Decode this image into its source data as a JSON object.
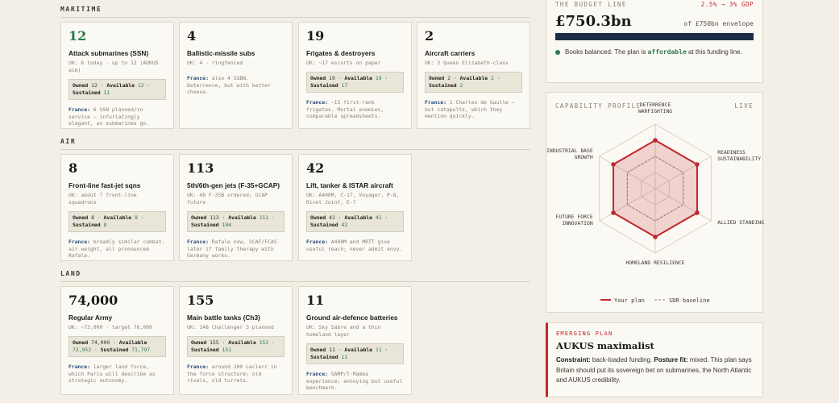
{
  "sections": {
    "maritime": "MARITIME",
    "air": "AIR",
    "land": "LAND"
  },
  "maritime": [
    {
      "num": "12",
      "title": "Attack submarines (SSN)",
      "uk": "UK: 6 today · up to 12 (AUKUS aim)",
      "owned": "12",
      "available": "12",
      "sustained": "11",
      "france_label": "France:",
      "france": "6 SSN planned/in service — infuriatingly elegant, as submarines go."
    },
    {
      "num": "4",
      "title": "Ballistic-missile subs",
      "uk": "UK: 4 · ringfenced",
      "france_label": "France:",
      "france": "also 4 SSBN. Deterrence, but with better cheese."
    },
    {
      "num": "19",
      "title": "Frigates & destroyers",
      "uk": "UK: ~17 escorts on paper",
      "owned": "19",
      "available": "19",
      "sustained": "17",
      "france_label": "France:",
      "france": "~15 first-rank frigates. Mortal enemies, comparable spreadsheets."
    },
    {
      "num": "2",
      "title": "Aircraft carriers",
      "uk": "UK: 2 Queen Elizabeth-class",
      "owned": "2",
      "available": "2",
      "sustained": "2",
      "france_label": "France:",
      "france": "1 Charles de Gaulle — but catapults, which they mention quickly."
    }
  ],
  "air": [
    {
      "num": "8",
      "title": "Front-line fast-jet sqns",
      "uk": "UK: about 7 front-line squadrons",
      "owned": "8",
      "available": "8",
      "sustained": "8",
      "france_label": "France:",
      "france": "broadly similar combat-air weight, all pronounced Rafale."
    },
    {
      "num": "113",
      "title": "5th/6th-gen jets (F-35+GCAP)",
      "uk": "UK: 48 F-35B ordered; GCAP future",
      "owned": "113",
      "available": "111",
      "sustained": "104",
      "france_label": "France:",
      "france": "Rafale now, SCAF/FCAS later if family therapy with Germany works."
    },
    {
      "num": "42",
      "title": "Lift, tanker & ISTAR aircraft",
      "uk": "UK: A400M, C-17, Voyager, P-8, Rivet Joint, E-7",
      "owned": "42",
      "available": "41",
      "sustained": "42",
      "france_label": "France:",
      "france": "A400M and MRTT give useful reach; never admit envy."
    }
  ],
  "land": [
    {
      "num": "74,000",
      "title": "Regular Army",
      "uk": "UK: ~73,000 · target 76,000",
      "owned": "74,000",
      "available": "72,952",
      "sustained": "71,797",
      "france_label": "France:",
      "france": "larger land force, which Paris will describe as strategic autonomy."
    },
    {
      "num": "155",
      "title": "Main battle tanks (Ch3)",
      "uk": "UK: 148 Challenger 3 planned",
      "owned": "155",
      "available": "153",
      "sustained": "151",
      "france_label": "France:",
      "france": "around 200 Leclerc in the force structure; old rivals, old turrets."
    },
    {
      "num": "11",
      "title": "Ground air-defence batteries",
      "uk": "UK: Sky Sabre and a thin homeland layer",
      "owned": "11",
      "available": "11",
      "sustained": "11",
      "france_label": "France:",
      "france": "SAMP/T-Mamba experience; annoying but useful benchmark."
    }
  ],
  "stat_labels": {
    "owned": "Owned",
    "available": "Available",
    "sustained": "Sustained",
    "sep": "·"
  },
  "budget": {
    "label": "THE BUDGET LINE",
    "pct": "2.5% → 3% GDP",
    "amount": "£750.3bn",
    "envelope": "of £750bn envelope",
    "fill": 1.0,
    "note_pre": "Books balanced. The plan is ",
    "note_status": "affordable",
    "note_post": " at this funding line.",
    "colors": {
      "bar": "#1e2c48",
      "ok": "#2c7a4b"
    }
  },
  "capability": {
    "title": "CAPABILITY PROFILE",
    "status": "LIVE",
    "axes": [
      [
        "DETERRENCE",
        "WARFIGHTING"
      ],
      [
        "READINESS",
        "SUSTAINABILITY"
      ],
      [
        "ALLIED STANDING"
      ],
      [
        "HOMELAND RESILIENCE"
      ],
      [
        "FUTURE FORCE",
        "INNOVATION"
      ],
      [
        "INDUSTRIAL BASE",
        "GROWTH"
      ]
    ],
    "plan_values": [
      0.75,
      0.75,
      0.75,
      0.75,
      0.75,
      0.75
    ],
    "baseline_values": [
      0.5,
      0.5,
      0.5,
      0.5,
      0.5,
      0.5
    ],
    "legend": {
      "plan": "Your plan",
      "baseline": "SDR baseline"
    },
    "colors": {
      "plan": "#c0272d",
      "baseline": "#8a8478"
    }
  },
  "emerging": {
    "tag": "EMERGING PLAN",
    "name": "AUKUS maximalist",
    "funding_label": "Constraint:",
    "funding": "back-loaded funding.",
    "fit_label": "Posture fit:",
    "fit": "mixed.",
    "desc": "This plan says Britain should put its sovereign bet on submarines, the North Atlantic and AUKUS credibility."
  }
}
